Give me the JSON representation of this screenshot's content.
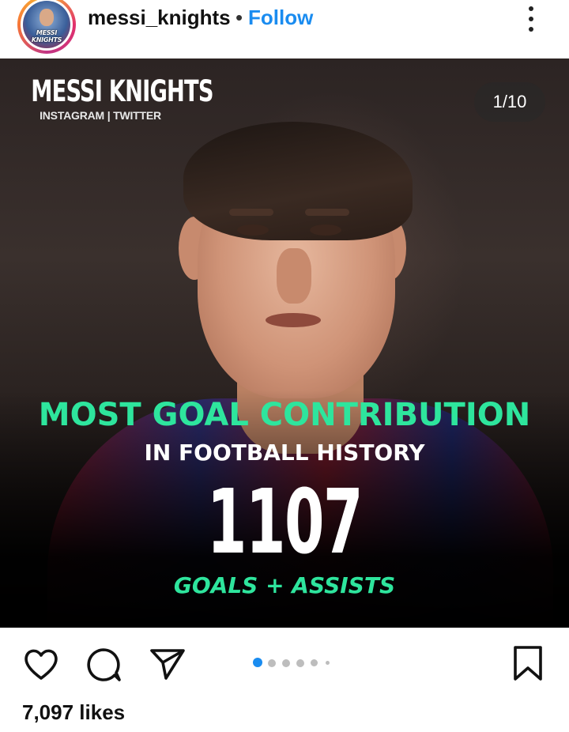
{
  "header": {
    "avatar_text": "MESSI KNIGHTS",
    "username": "messi_knights",
    "separator": "•",
    "follow_label": "Follow",
    "follow_color": "#1a8cf0",
    "more_icon": "more-vertical-icon"
  },
  "post": {
    "brand_title": "MESSI KNIGHTS",
    "brand_subtitle": "INSTAGRAM | TWITTER",
    "slide_counter": "1/10",
    "headline": "MOST GOAL CONTRIBUTION",
    "subheadline": "IN FOOTBALL HISTORY",
    "big_number": "1107",
    "number_caption": "GOALS + ASSISTS",
    "accent_color": "#2ee59d",
    "current_slide": 1,
    "total_slides": 10
  },
  "actions": {
    "like_icon": "heart-icon",
    "comment_icon": "comment-icon",
    "share_icon": "share-icon",
    "save_icon": "bookmark-icon",
    "active_dot_color": "#1a8cf0"
  },
  "likes": {
    "text": "7,097 likes"
  }
}
